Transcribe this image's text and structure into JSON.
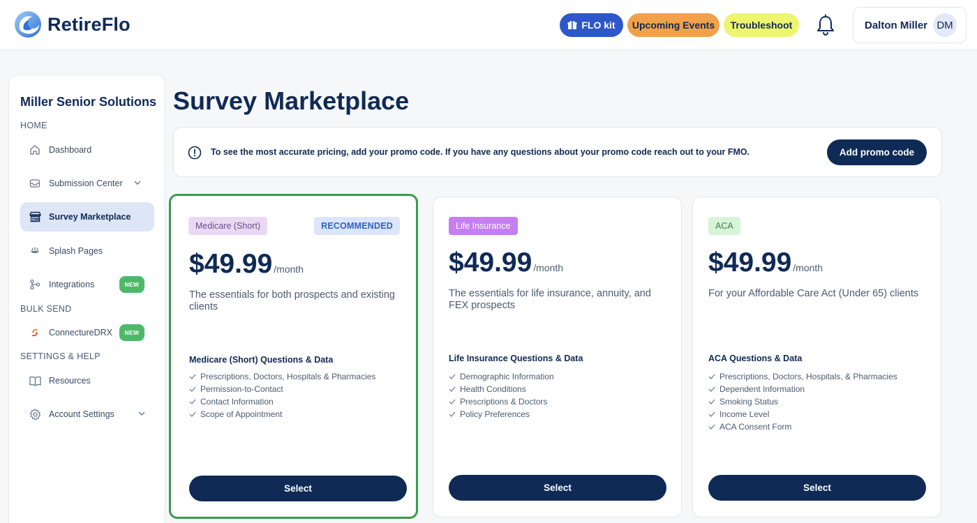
{
  "app": {
    "name": "RetireFlo",
    "logo_icon": "wave-logo-icon"
  },
  "header": {
    "buttons": [
      {
        "label": "FLO kit",
        "icon": "gift-icon",
        "color": "#2e57c9"
      },
      {
        "label": "Upcoming Events",
        "color": "#f1a14a"
      },
      {
        "label": "Troubleshoot",
        "color": "#eef56e"
      }
    ],
    "notification_icon": "bell-icon",
    "user": {
      "name": "Dalton Miller",
      "initials": "DM"
    }
  },
  "sidebar": {
    "org_name": "Miller Senior Solutions",
    "sections": {
      "home": "HOME",
      "bulk_send": "BULK SEND",
      "settings_help": "SETTINGS & HELP"
    },
    "items": [
      {
        "label": "Dashboard",
        "icon": "home-icon"
      },
      {
        "label": "Submission Center",
        "icon": "inbox-icon",
        "expandable": true
      },
      {
        "label": "Survey Marketplace",
        "icon": "store-icon",
        "active": true
      },
      {
        "label": "Splash Pages",
        "icon": "splash-icon"
      },
      {
        "label": "Integrations",
        "icon": "integrations-icon",
        "badge": "NEW"
      },
      {
        "label": "ConnectureDRX",
        "icon": "connecture-icon",
        "badge": "NEW"
      },
      {
        "label": "Resources",
        "icon": "book-icon"
      },
      {
        "label": "Account Settings",
        "icon": "gear-icon",
        "expandable": true
      }
    ]
  },
  "main": {
    "title": "Survey Marketplace",
    "promo": {
      "text": "To see the most accurate pricing, add your promo code. If you have any questions about your promo code reach out to your FMO.",
      "button": "Add promo code"
    },
    "cards": [
      {
        "tag": "Medicare (Short)",
        "tag_bg": "#ead9f4",
        "tag_fg": "#6b4f86",
        "recommended": "RECOMMENDED",
        "price": "$49.99",
        "period": "/month",
        "description": "The essentials for both prospects and existing clients",
        "features_title": "Medicare (Short) Questions & Data",
        "features": [
          "Prescriptions, Doctors, Hospitals & Pharmacies",
          "Permission-to-Contact",
          "Contact Information",
          "Scope of Appointment"
        ],
        "button": "Select"
      },
      {
        "tag": "Life Insurance",
        "tag_bg": "#c57ff0",
        "tag_fg": "#ffffff",
        "price": "$49.99",
        "period": "/month",
        "description": "The essentials for life insurance, annuity, and FEX prospects",
        "features_title": "Life Insurance Questions & Data",
        "features": [
          "Demographic Information",
          "Health Conditions",
          "Prescriptions & Doctors",
          "Policy Preferences"
        ],
        "button": "Select"
      },
      {
        "tag": "ACA",
        "tag_bg": "#d7f3d8",
        "tag_fg": "#3f7f4a",
        "price": "$49.99",
        "period": "/month",
        "description": "For your Affordable Care Act (Under 65) clients",
        "features_title": "ACA Questions & Data",
        "features": [
          "Prescriptions, Doctors, Hospitals, & Pharmacies",
          "Dependent Information",
          "Smoking Status",
          "Income Level",
          "ACA Consent Form"
        ],
        "button": "Select"
      }
    ]
  }
}
